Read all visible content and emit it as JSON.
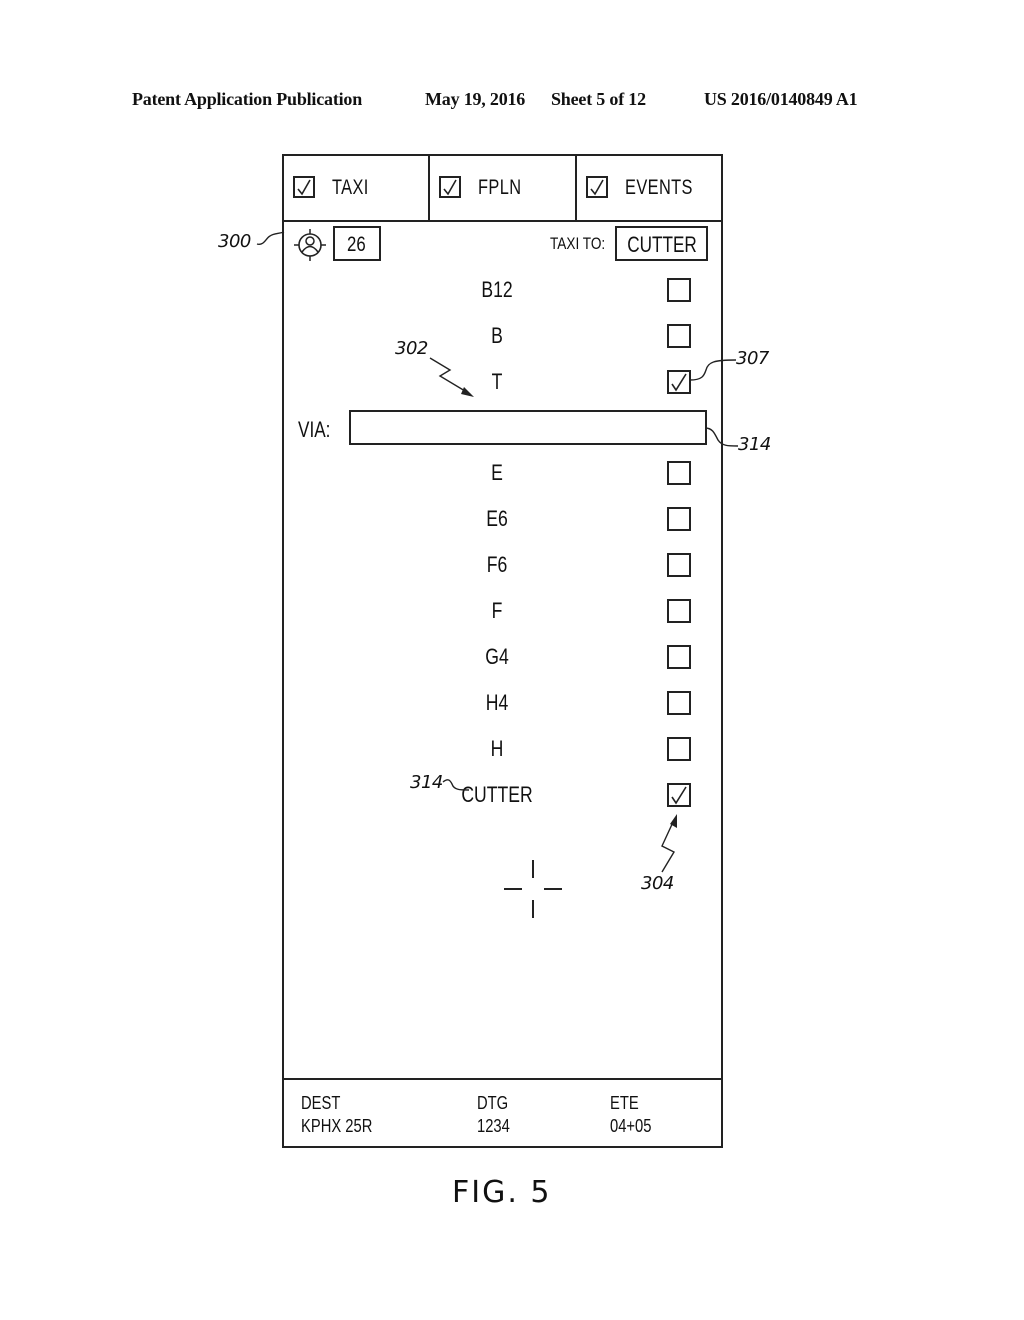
{
  "header": {
    "publication": "Patent Application Publication",
    "date": "May 19, 2016",
    "sheet": "Sheet 5 of 12",
    "number": "US 2016/0140849 A1"
  },
  "tabs": [
    {
      "label": "TAXI",
      "checked": true
    },
    {
      "label": "FPLN",
      "checked": true
    },
    {
      "label": "EVENTS",
      "checked": true
    }
  ],
  "toolbar": {
    "runway_icon": "runway-target-icon",
    "runway_value": "26",
    "taxi_to_label": "TAXI TO:",
    "taxi_to_value": "CUTTER"
  },
  "via": {
    "label": "VIA:",
    "value": ""
  },
  "taxiways_before_via": [
    {
      "label": "B12",
      "checked": false
    },
    {
      "label": "B",
      "checked": false
    },
    {
      "label": "T",
      "checked": true
    }
  ],
  "taxiways_after_via": [
    {
      "label": "E",
      "checked": false
    },
    {
      "label": "E6",
      "checked": false
    },
    {
      "label": "F6",
      "checked": false
    },
    {
      "label": "F",
      "checked": false
    },
    {
      "label": "G4",
      "checked": false
    },
    {
      "label": "H4",
      "checked": false
    },
    {
      "label": "H",
      "checked": false
    },
    {
      "label": "CUTTER",
      "checked": true
    }
  ],
  "footer": [
    {
      "label": "DEST",
      "value": "KPHX 25R"
    },
    {
      "label": "DTG",
      "value": "1234"
    },
    {
      "label": "ETE",
      "value": "04+05"
    }
  ],
  "reference_numerals": {
    "r300": "300",
    "r302": "302",
    "r307": "307",
    "r314a": "314",
    "r314b": "314",
    "r304": "304"
  },
  "figure_label": "FIG. 5"
}
